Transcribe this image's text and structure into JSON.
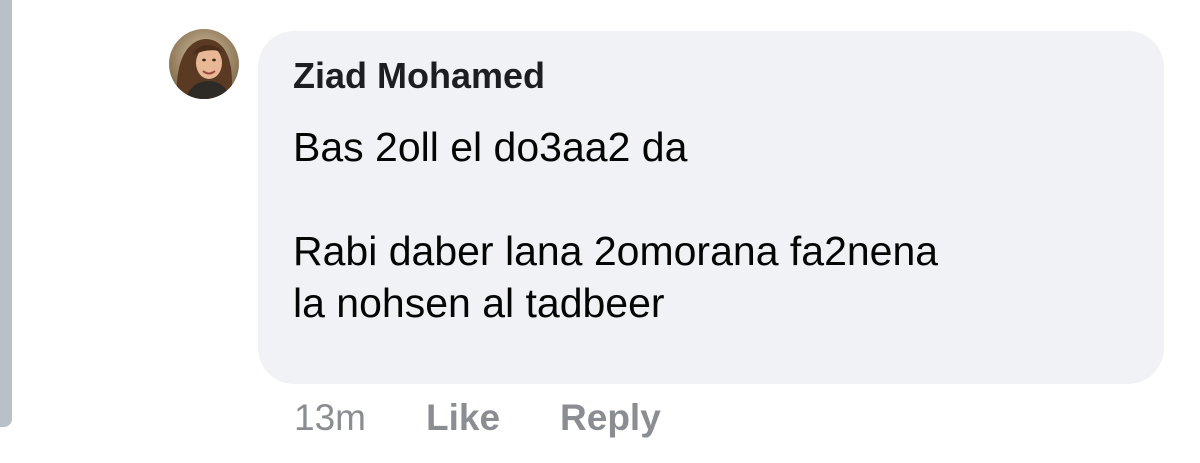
{
  "comment": {
    "author": "Ziad Mohamed",
    "text_lines": [
      "Bas 2oll el do3aa2 da",
      "",
      "Rabi daber lana 2omorana fa2nena",
      "la nohsen al tadbeer"
    ],
    "timestamp": "13m",
    "actions": {
      "like_label": "Like",
      "reply_label": "Reply"
    }
  },
  "colors": {
    "bubble_background": "#f0f2f5",
    "author_text": "#1c1e21",
    "comment_text": "#050505",
    "action_text": "#8a8d91",
    "thread_line": "#b9c0c8"
  },
  "icons": {
    "avatar": "profile-photo"
  }
}
